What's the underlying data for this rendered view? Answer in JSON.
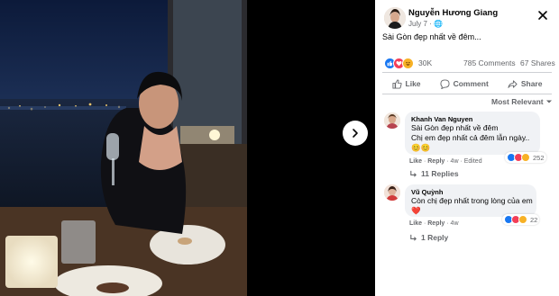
{
  "post": {
    "author": "Nguyễn Hương Giang",
    "time": "July 7 · 🌐",
    "caption": "Sài Gòn đẹp nhất về đêm...",
    "reaction_count": "30K",
    "comments_count": "785 Comments",
    "shares_count": "67 Shares"
  },
  "actions": {
    "like": "Like",
    "comment": "Comment",
    "share": "Share"
  },
  "sort_label": "Most Relevant",
  "comments": [
    {
      "author": "Khanh Van Nguyen",
      "lines": [
        "Sài Gòn đẹp nhất về đêm",
        "Chị em đẹp nhất cả đêm lẫn ngày..",
        "😊😊"
      ],
      "like": "Like",
      "reply": "Reply",
      "time": "4w",
      "edited": "Edited",
      "reaction_count": "252",
      "replies": "11 Replies"
    },
    {
      "author": "Vũ Quỳnh",
      "lines": [
        "Còn chị đẹp nhất trong lòng của em",
        "❤️"
      ],
      "like": "Like",
      "reply": "Reply",
      "time": "4w",
      "reaction_count": "22",
      "replies": "1 Reply"
    }
  ],
  "colors": {
    "like_blue": "#1877f2",
    "love_red": "#f33e58",
    "haha_yellow": "#f7b125",
    "text_secondary": "#65676b"
  }
}
